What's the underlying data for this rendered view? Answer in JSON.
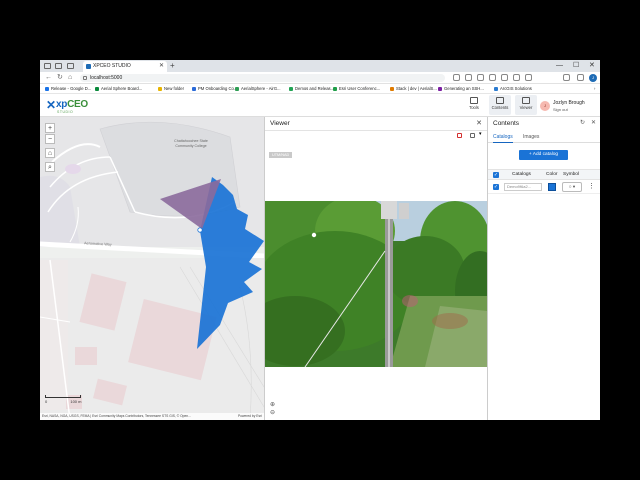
{
  "browser": {
    "tab_title": "XPCEO STUDIO",
    "tab_close": "✕",
    "new_tab": "+",
    "window_controls": {
      "minimize": "—",
      "maximize": "☐",
      "close": "✕"
    },
    "nav": {
      "back": "←",
      "refresh": "↻",
      "home": "⌂"
    },
    "url": "localhost:5000",
    "bookmarks": [
      {
        "label": "Release - Google D...",
        "color": "#1a73e8"
      },
      {
        "label": "Aerial Sphere Board...",
        "color": "#0a8a3c"
      },
      {
        "label": "New folder",
        "color": "#e8b400"
      },
      {
        "label": "PM Onboarding Co...",
        "color": "#2a6ad8"
      },
      {
        "label": "AerialSphere - AirG...",
        "color": "#2f9e55"
      },
      {
        "label": "Demos and Releas...",
        "color": "#23a455"
      },
      {
        "label": "Esri User Conferenc...",
        "color": "#1f9e48"
      },
      {
        "label": "Stack | dev | AerialS...",
        "color": "#e07b00"
      },
      {
        "label": "Generating an SSH...",
        "color": "#7b1fa2"
      },
      {
        "label": "ArcGIS Solutions",
        "color": "#2b7bd0"
      }
    ],
    "bookmarks_more": "›"
  },
  "app": {
    "logo_mark": "✕",
    "logo_text_a": "xp",
    "logo_text_b": "CEO",
    "logo_sub": "STUDIO",
    "header_buttons": [
      {
        "label": "Tools",
        "active": false
      },
      {
        "label": "Contents",
        "active": true
      },
      {
        "label": "Viewer",
        "active": true
      }
    ],
    "user": {
      "initial": "J",
      "name": "Jozlyn Brough",
      "action": "Sign out"
    }
  },
  "map": {
    "zoom_in": "+",
    "zoom_out": "−",
    "home": "⌂",
    "search": "⌕",
    "labels": {
      "college": "Chattahoochee State Community College",
      "road": "Aeromotive Way"
    },
    "scale": {
      "zero": "0",
      "end": "100 m"
    },
    "attribution": "Esri, NASA, NGA, USGS, FEMA | Esri Community Maps Contributors, Tennessee STS GIS, © Open...",
    "powered_by": "Powered by Esri",
    "footprint_color": "#1a73d6",
    "view_cone_color": "#8b6a9c"
  },
  "viewer": {
    "title": "Viewer",
    "close": "✕",
    "badge": "UTM/NAD",
    "zoom_in": "⊕",
    "zoom_out": "⊖"
  },
  "contents": {
    "title": "Contents",
    "tabs": [
      "Catalogs",
      "Images"
    ],
    "active_tab": "Catalogs",
    "add_button": "+ Add catalog",
    "columns": [
      "Catalogs",
      "Color",
      "Symbol"
    ],
    "rows": [
      {
        "name": "Demo9f6a2...",
        "checked": true,
        "color": "#1a73d6",
        "symbol": "○ ▾"
      }
    ],
    "kebab": "⋮",
    "controls": {
      "refresh": "↻",
      "close": "✕"
    }
  }
}
